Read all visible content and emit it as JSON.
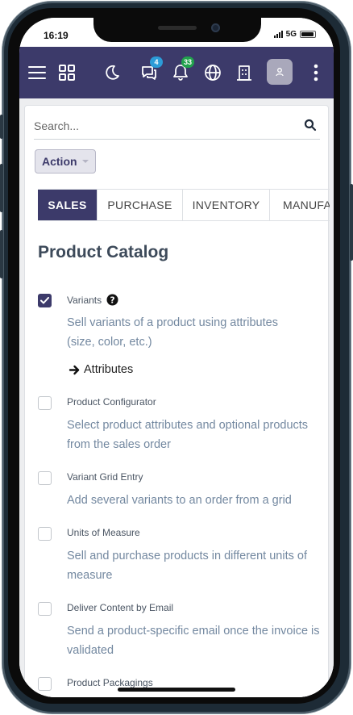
{
  "status_bar": {
    "time": "16:19",
    "network": "5G"
  },
  "navbar": {
    "messages_badge": "4",
    "notifications_badge": "33"
  },
  "search": {
    "placeholder": "Search..."
  },
  "action_button": {
    "label": "Action"
  },
  "tabs": [
    {
      "label": "SALES",
      "active": true
    },
    {
      "label": "PURCHASE",
      "active": false
    },
    {
      "label": "INVENTORY",
      "active": false
    },
    {
      "label": "MANUFA",
      "active": false
    }
  ],
  "section": {
    "title": "Product Catalog",
    "settings": [
      {
        "label": "Variants",
        "checked": true,
        "help": true,
        "description": "Sell variants of a product using attributes (size, color, etc.)",
        "link": "Attributes"
      },
      {
        "label": "Product Configurator",
        "checked": false,
        "description": "Select product attributes and optional products from the sales order"
      },
      {
        "label": "Variant Grid Entry",
        "checked": false,
        "description": "Add several variants to an order from a grid"
      },
      {
        "label": "Units of Measure",
        "checked": false,
        "description": "Sell and purchase products in different units of measure"
      },
      {
        "label": "Deliver Content by Email",
        "checked": false,
        "description": "Send a product-specific email once the invoice is validated"
      },
      {
        "label": "Product Packagings",
        "checked": false,
        "description": ""
      }
    ]
  },
  "colors": {
    "brand": "#3c3a6a",
    "description_text": "#7388a0"
  }
}
